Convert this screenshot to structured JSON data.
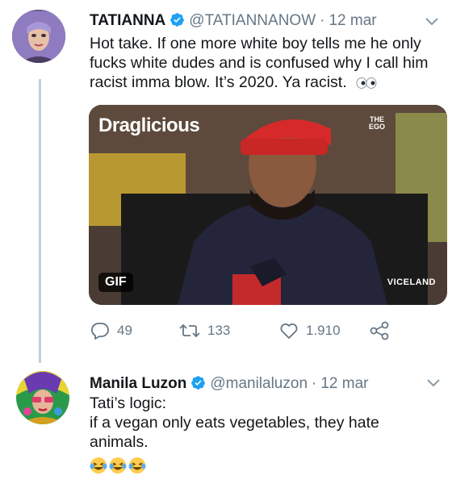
{
  "tweets": [
    {
      "display_name": "TATIANNA",
      "handle": "@TATIANNANOW",
      "separator": "·",
      "timestamp": "12 mar",
      "text_lines": [
        "Hot take. If one more white boy tells me he only",
        "fucks white dudes and is confused why I call him",
        "racist imma blow. It’s 2020. Ya racist."
      ],
      "avatar_icon": "avatar-purple-hair",
      "media": {
        "type": "gif",
        "badge": "GIF",
        "brand": "Draglicious",
        "watermark": "VICELAND",
        "cap_text": "THE EGO"
      },
      "actions": {
        "reply_count": "49",
        "retweet_count": "133",
        "like_count": "1.910"
      }
    },
    {
      "display_name": "Manila Luzon",
      "handle": "@manilaluzon",
      "separator": "·",
      "timestamp": "12 mar",
      "text_lines": [
        "Tati’s logic:",
        "if a vegan only eats vegetables, they hate",
        "animals."
      ],
      "avatar_icon": "avatar-drag-colorful",
      "emojis": [
        "laughing-tears-emoji",
        "laughing-tears-emoji",
        "laughing-tears-emoji"
      ]
    }
  ],
  "colors": {
    "verified": "#1da1f2",
    "secondary_text": "#657786",
    "thread_line": "#c4cfd6"
  }
}
